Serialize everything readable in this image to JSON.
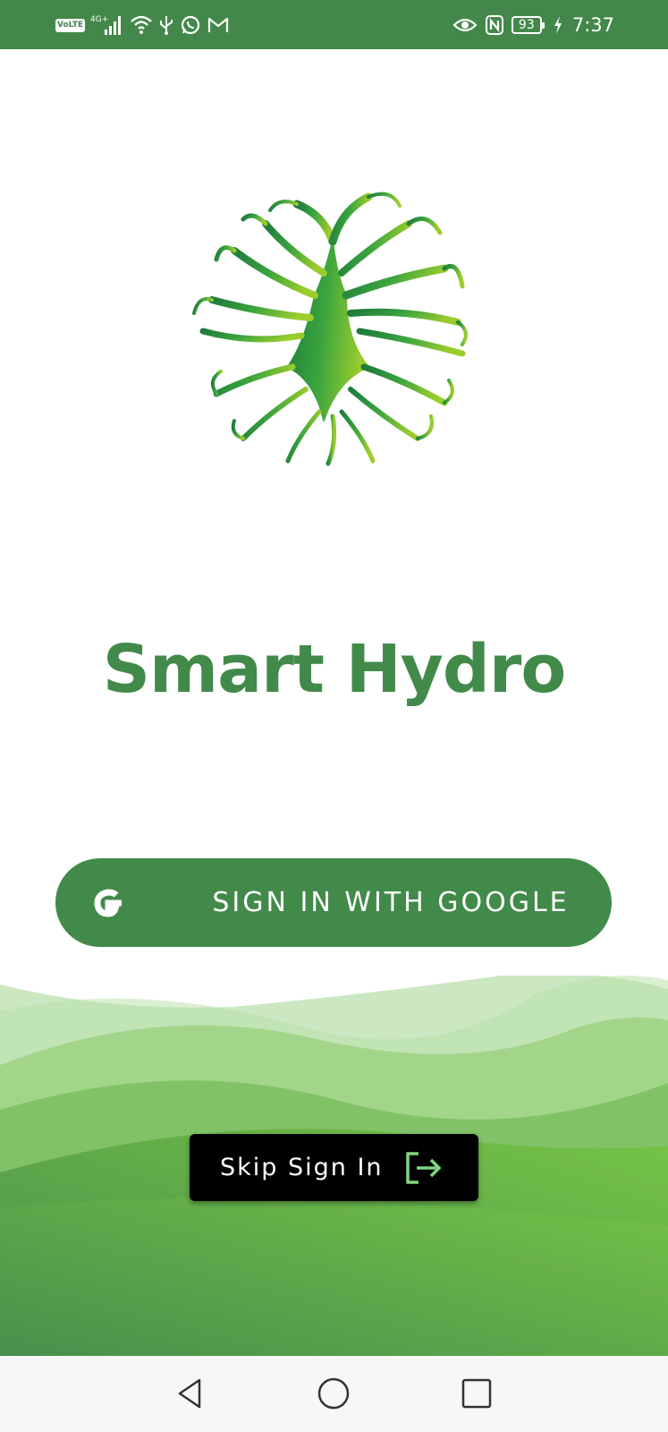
{
  "status_bar": {
    "network_badge": "VoLTE",
    "network_type": "4G+",
    "battery": "93",
    "time": "7:37",
    "icons_left": [
      "volte-icon",
      "signal-icon",
      "wifi-icon",
      "usb-icon",
      "whatsapp-icon",
      "gmail-icon"
    ],
    "icons_right": [
      "eye-icon",
      "nfc-icon",
      "battery-icon",
      "charging-icon"
    ]
  },
  "app": {
    "title": "Smart Hydro"
  },
  "google_button": {
    "label": "SIGN IN WITH GOOGLE",
    "icon": "google-icon"
  },
  "skip_button": {
    "label": "Skip Sign In",
    "icon": "exit-icon"
  },
  "nav_bar": {
    "buttons": [
      "back-icon",
      "home-icon",
      "recents-icon"
    ]
  },
  "colors": {
    "primary_green": "#428a4a",
    "status_bar": "#43884a",
    "skip_icon_green": "#7ed67f",
    "button_black": "#000000"
  }
}
